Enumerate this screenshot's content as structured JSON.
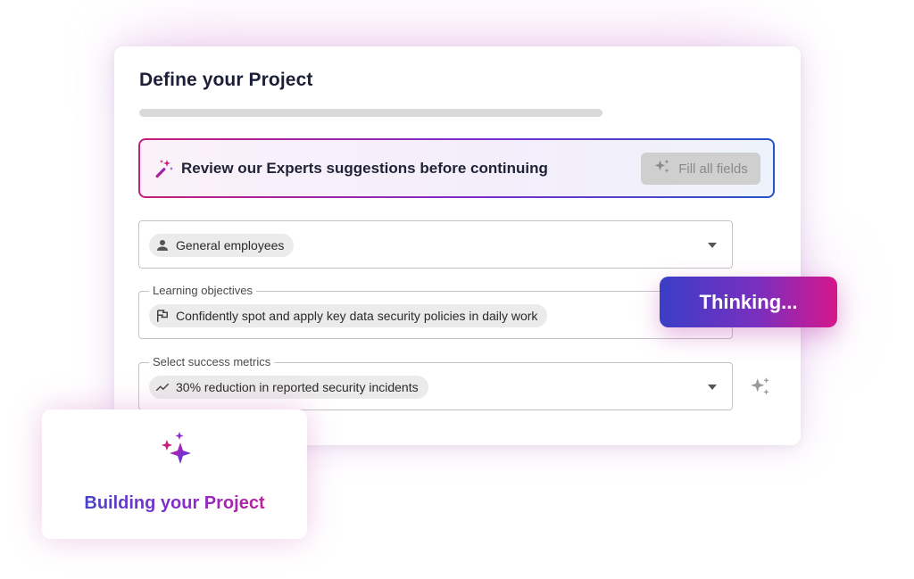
{
  "form": {
    "title": "Define your Project",
    "progress_fraction": 0.0,
    "banner": {
      "text": "Review our Experts suggestions before continuing",
      "icon": "magic-wand-icon",
      "fill_button_label": "Fill all fields",
      "fill_button_icon": "sparkles-icon"
    },
    "audience_field": {
      "value": "General employees",
      "icon": "person-icon"
    },
    "objectives_field": {
      "label": "Learning objectives",
      "value": "Confidently spot and apply key data security policies in daily work",
      "icon": "flag-icon"
    },
    "metrics_field": {
      "label": "Select success metrics",
      "value": "30% reduction in reported security incidents",
      "icon": "trend-line-icon"
    }
  },
  "thinking_badge": {
    "text": "Thinking..."
  },
  "building_card": {
    "text": "Building your Project",
    "icon": "sparkles-gradient-icon"
  },
  "colors": {
    "accent_pink": "#d6178a",
    "accent_purple": "#7a2fbf",
    "accent_blue": "#2f4fc4",
    "title_text": "#1b2038"
  }
}
